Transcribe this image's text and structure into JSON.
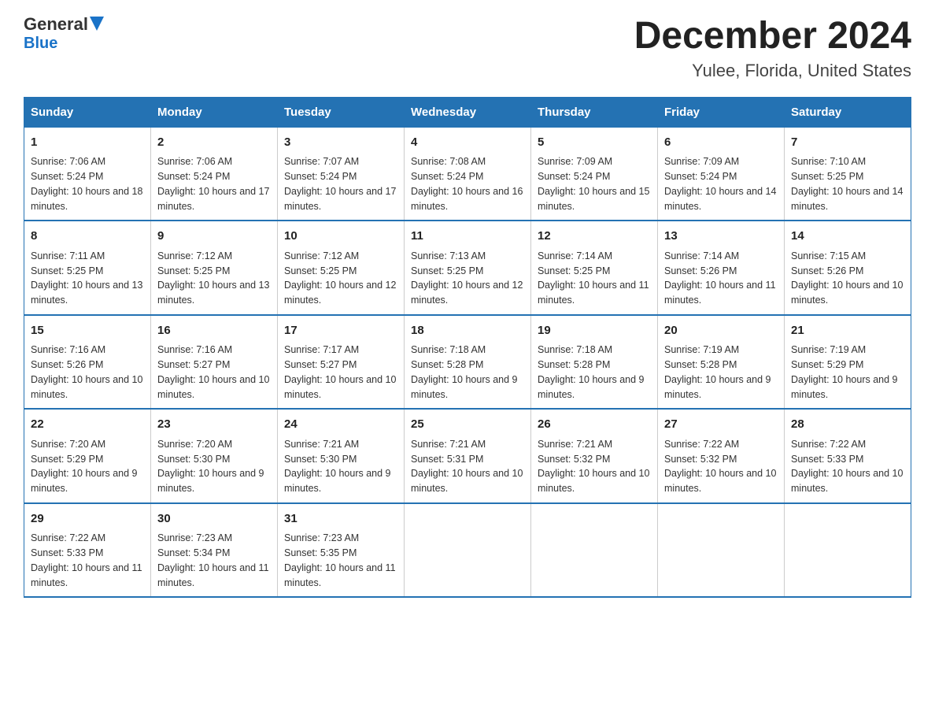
{
  "logo": {
    "general": "General",
    "blue": "Blue"
  },
  "title": "December 2024",
  "subtitle": "Yulee, Florida, United States",
  "days": [
    "Sunday",
    "Monday",
    "Tuesday",
    "Wednesday",
    "Thursday",
    "Friday",
    "Saturday"
  ],
  "weeks": [
    [
      {
        "day": "1",
        "sunrise": "7:06 AM",
        "sunset": "5:24 PM",
        "daylight": "10 hours and 18 minutes."
      },
      {
        "day": "2",
        "sunrise": "7:06 AM",
        "sunset": "5:24 PM",
        "daylight": "10 hours and 17 minutes."
      },
      {
        "day": "3",
        "sunrise": "7:07 AM",
        "sunset": "5:24 PM",
        "daylight": "10 hours and 17 minutes."
      },
      {
        "day": "4",
        "sunrise": "7:08 AM",
        "sunset": "5:24 PM",
        "daylight": "10 hours and 16 minutes."
      },
      {
        "day": "5",
        "sunrise": "7:09 AM",
        "sunset": "5:24 PM",
        "daylight": "10 hours and 15 minutes."
      },
      {
        "day": "6",
        "sunrise": "7:09 AM",
        "sunset": "5:24 PM",
        "daylight": "10 hours and 14 minutes."
      },
      {
        "day": "7",
        "sunrise": "7:10 AM",
        "sunset": "5:25 PM",
        "daylight": "10 hours and 14 minutes."
      }
    ],
    [
      {
        "day": "8",
        "sunrise": "7:11 AM",
        "sunset": "5:25 PM",
        "daylight": "10 hours and 13 minutes."
      },
      {
        "day": "9",
        "sunrise": "7:12 AM",
        "sunset": "5:25 PM",
        "daylight": "10 hours and 13 minutes."
      },
      {
        "day": "10",
        "sunrise": "7:12 AM",
        "sunset": "5:25 PM",
        "daylight": "10 hours and 12 minutes."
      },
      {
        "day": "11",
        "sunrise": "7:13 AM",
        "sunset": "5:25 PM",
        "daylight": "10 hours and 12 minutes."
      },
      {
        "day": "12",
        "sunrise": "7:14 AM",
        "sunset": "5:25 PM",
        "daylight": "10 hours and 11 minutes."
      },
      {
        "day": "13",
        "sunrise": "7:14 AM",
        "sunset": "5:26 PM",
        "daylight": "10 hours and 11 minutes."
      },
      {
        "day": "14",
        "sunrise": "7:15 AM",
        "sunset": "5:26 PM",
        "daylight": "10 hours and 10 minutes."
      }
    ],
    [
      {
        "day": "15",
        "sunrise": "7:16 AM",
        "sunset": "5:26 PM",
        "daylight": "10 hours and 10 minutes."
      },
      {
        "day": "16",
        "sunrise": "7:16 AM",
        "sunset": "5:27 PM",
        "daylight": "10 hours and 10 minutes."
      },
      {
        "day": "17",
        "sunrise": "7:17 AM",
        "sunset": "5:27 PM",
        "daylight": "10 hours and 10 minutes."
      },
      {
        "day": "18",
        "sunrise": "7:18 AM",
        "sunset": "5:28 PM",
        "daylight": "10 hours and 9 minutes."
      },
      {
        "day": "19",
        "sunrise": "7:18 AM",
        "sunset": "5:28 PM",
        "daylight": "10 hours and 9 minutes."
      },
      {
        "day": "20",
        "sunrise": "7:19 AM",
        "sunset": "5:28 PM",
        "daylight": "10 hours and 9 minutes."
      },
      {
        "day": "21",
        "sunrise": "7:19 AM",
        "sunset": "5:29 PM",
        "daylight": "10 hours and 9 minutes."
      }
    ],
    [
      {
        "day": "22",
        "sunrise": "7:20 AM",
        "sunset": "5:29 PM",
        "daylight": "10 hours and 9 minutes."
      },
      {
        "day": "23",
        "sunrise": "7:20 AM",
        "sunset": "5:30 PM",
        "daylight": "10 hours and 9 minutes."
      },
      {
        "day": "24",
        "sunrise": "7:21 AM",
        "sunset": "5:30 PM",
        "daylight": "10 hours and 9 minutes."
      },
      {
        "day": "25",
        "sunrise": "7:21 AM",
        "sunset": "5:31 PM",
        "daylight": "10 hours and 10 minutes."
      },
      {
        "day": "26",
        "sunrise": "7:21 AM",
        "sunset": "5:32 PM",
        "daylight": "10 hours and 10 minutes."
      },
      {
        "day": "27",
        "sunrise": "7:22 AM",
        "sunset": "5:32 PM",
        "daylight": "10 hours and 10 minutes."
      },
      {
        "day": "28",
        "sunrise": "7:22 AM",
        "sunset": "5:33 PM",
        "daylight": "10 hours and 10 minutes."
      }
    ],
    [
      {
        "day": "29",
        "sunrise": "7:22 AM",
        "sunset": "5:33 PM",
        "daylight": "10 hours and 11 minutes."
      },
      {
        "day": "30",
        "sunrise": "7:23 AM",
        "sunset": "5:34 PM",
        "daylight": "10 hours and 11 minutes."
      },
      {
        "day": "31",
        "sunrise": "7:23 AM",
        "sunset": "5:35 PM",
        "daylight": "10 hours and 11 minutes."
      },
      null,
      null,
      null,
      null
    ]
  ],
  "labels": {
    "sunrise": "Sunrise:",
    "sunset": "Sunset:",
    "daylight": "Daylight:"
  }
}
